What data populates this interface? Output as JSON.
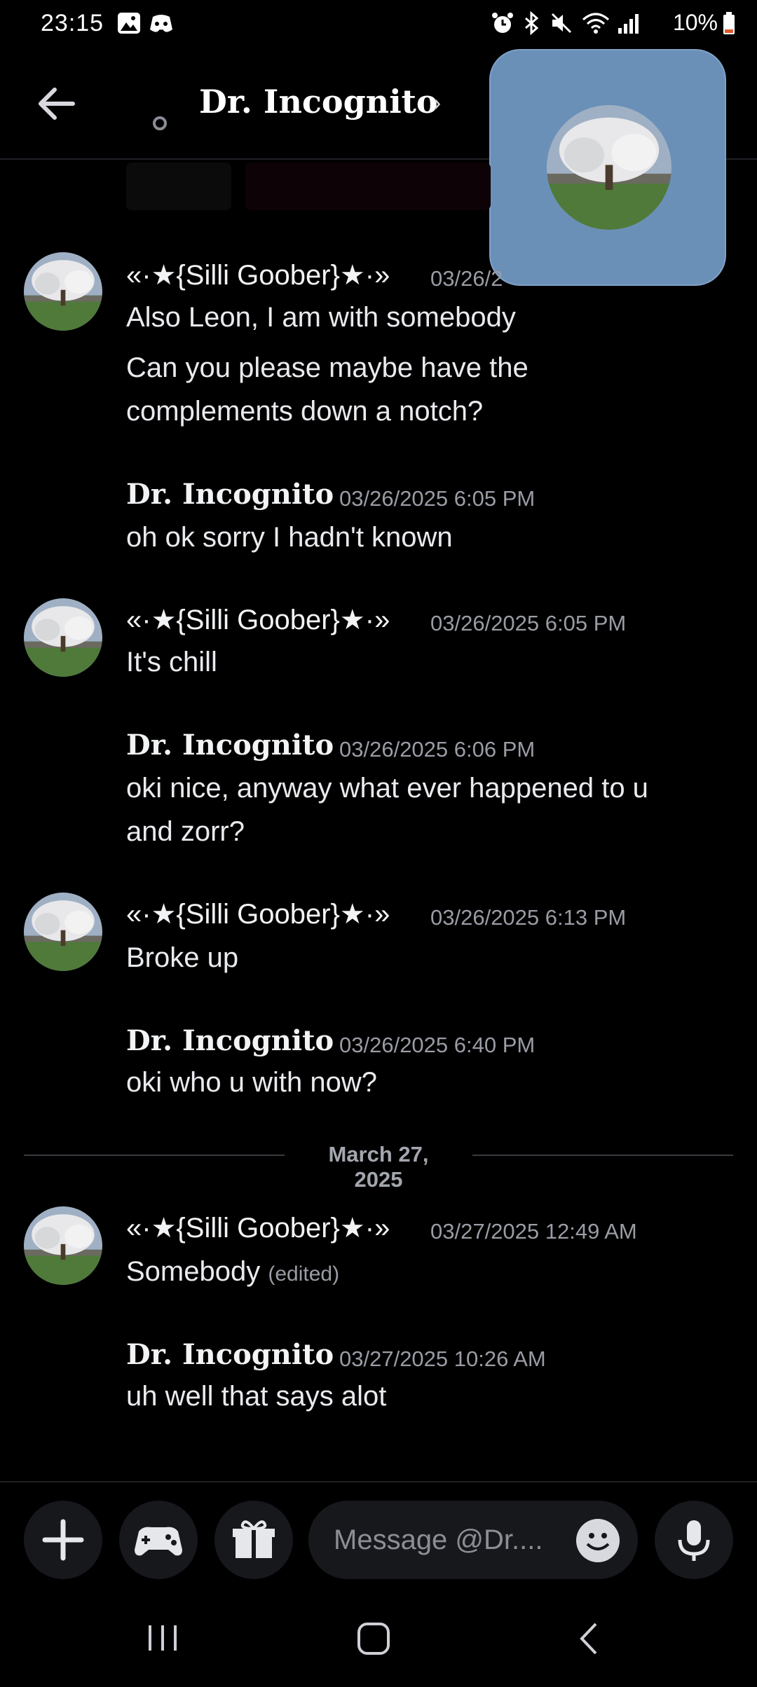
{
  "status_bar": {
    "time": "23:15",
    "battery": "10%"
  },
  "header": {
    "title": "Dr. Incognito",
    "chevron": "›"
  },
  "divider": {
    "label": "March 27, 2025"
  },
  "messages": [
    {
      "author": "«·★{Silli Goober}★·»",
      "timestamp": "03/26/2",
      "lines": [
        "Also Leon, I am with somebody",
        "Can you please maybe have the",
        "complements down a notch?"
      ]
    },
    {
      "author": "Dr. Incognito",
      "timestamp": "03/26/2025 6:05 PM",
      "lines": [
        "oh ok sorry I hadn't known"
      ]
    },
    {
      "author": "«·★{Silli Goober}★·»",
      "timestamp": "03/26/2025 6:05 PM",
      "lines": [
        "It's chill"
      ]
    },
    {
      "author": "Dr. Incognito",
      "timestamp": "03/26/2025 6:06 PM",
      "lines": [
        "oki nice, anyway what ever happened to u",
        "and zorr?"
      ]
    },
    {
      "author": "«·★{Silli Goober}★·»",
      "timestamp": "03/26/2025 6:13 PM",
      "lines": [
        "Broke up"
      ]
    },
    {
      "author": "Dr. Incognito",
      "timestamp": "03/26/2025 6:40 PM",
      "lines": [
        "oki who u with now?"
      ]
    },
    {
      "author": "«·★{Silli Goober}★·»",
      "timestamp": "03/27/2025 12:49 AM",
      "lines": [
        "Somebody"
      ],
      "edited": "(edited)"
    },
    {
      "author": "Dr. Incognito",
      "timestamp": "03/27/2025 10:26 AM",
      "lines": [
        "uh well that says alot"
      ]
    }
  ],
  "composer": {
    "placeholder": "Message @Dr...."
  },
  "icons": {
    "status": [
      "image-icon",
      "discord-icon",
      "alarm-icon",
      "bluetooth-icon",
      "mute-icon",
      "wifi-icon",
      "signal-icon",
      "battery-icon"
    ],
    "header": [
      "back-arrow-icon"
    ],
    "composer": [
      "plus-icon",
      "gamepad-icon",
      "gift-icon",
      "emoji-icon",
      "microphone-icon"
    ],
    "nav": [
      "recent-apps-icon",
      "home-icon",
      "back-nav-icon"
    ]
  },
  "colors": {
    "background": "#000000",
    "pip": "#6a90b8",
    "text": "#e9eaee",
    "muted": "#9a9ca5"
  }
}
